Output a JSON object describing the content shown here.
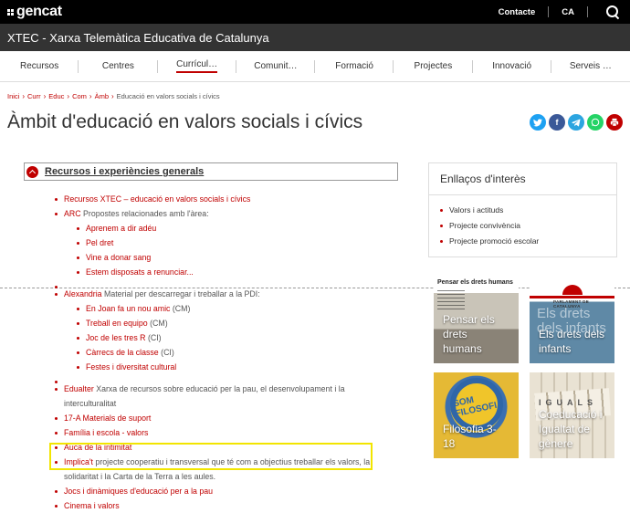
{
  "topbar": {
    "logo": "gencat",
    "contact": "Contacte",
    "lang": "CA"
  },
  "site": {
    "title": "XTEC - Xarxa Telemàtica Educativa de Catalunya"
  },
  "nav": {
    "items": [
      "Recursos",
      "Centres",
      "Currícul…",
      "Comunit…",
      "Formació",
      "Projectes",
      "Innovació",
      "Serveis …"
    ]
  },
  "breadcrumb": {
    "items": [
      "Inici",
      "Curr",
      "Educ",
      "Com",
      "Àmb"
    ],
    "current": "Educació en valors socials i cívics"
  },
  "page": {
    "title": "Àmbit d'educació en valors socials i cívics"
  },
  "colors": {
    "accent": "#c00000",
    "twitter": "#1da1f2",
    "facebook": "#3b5998",
    "telegram": "#2ca5e0",
    "whatsapp": "#25d366",
    "print": "#c00000"
  },
  "section": {
    "title": "Recursos i experiències generals",
    "items": {
      "xtec": {
        "link": "Recursos XTEC – educació en valors socials i cívics"
      },
      "arc": {
        "link": "ARC",
        "desc": " Propostes relacionades amb l'àrea:",
        "sub": [
          "Aprenem a dir adéu",
          "Pel dret",
          "Vine a donar sang",
          "Estem disposats a renunciar..."
        ]
      },
      "alexandria": {
        "link": "Alexandria",
        "desc": " Material per descarregar i treballar a la PDI:",
        "sub": [
          {
            "link": "En Joan fa un nou amic",
            "tag": " (CM)"
          },
          {
            "link": "Treball en equipo",
            "tag": " (CM)"
          },
          {
            "link": "Joc de les tres R",
            "tag": " (CI)"
          },
          {
            "link": "Càrrecs de la classe",
            "tag": " (CI)"
          },
          {
            "link": "Festes i diversitat cultural",
            "tag": ""
          }
        ]
      },
      "edualter": {
        "link": "Edualter",
        "desc": " Xarxa de recursos sobre educació per la pau, el desenvolupament i la interculturalitat"
      },
      "materials": {
        "link": "17-A Materials de suport"
      },
      "familia": {
        "link": "Família i escola - valors"
      },
      "auca": {
        "link": "Auca de la intimitat"
      },
      "implicat": {
        "link": "Implica't",
        "desc": " projecte cooperatiu i transversal que té com a objectius treballar els valors, la solidaritat i la Carta de la Terra a les aules."
      },
      "jocs": {
        "link": "Jocs i dinàmiques d'educació per a la pau"
      },
      "cinema": {
        "link": "Cinema i valors"
      }
    }
  },
  "sidebar": {
    "title": "Enllaços d'interès",
    "links": [
      "Valors i actituds",
      "Projecte convivència",
      "Projecte promoció escolar"
    ],
    "tiles": {
      "t1": {
        "label": "Pensar els drets humans",
        "header": "Pensar els drets humans"
      },
      "t2": {
        "label": "Els drets dels infants",
        "header": "PARLAMENT DE CATALUNYA",
        "bg_text": "Els drets dels infants"
      },
      "t3": {
        "label": "Filosofia 3-18",
        "bg_text": "SOM FILOSOFIA"
      },
      "t4": {
        "label": "Coeducació i Igualtat de gènere",
        "bg_text": "IGUALS"
      }
    }
  }
}
